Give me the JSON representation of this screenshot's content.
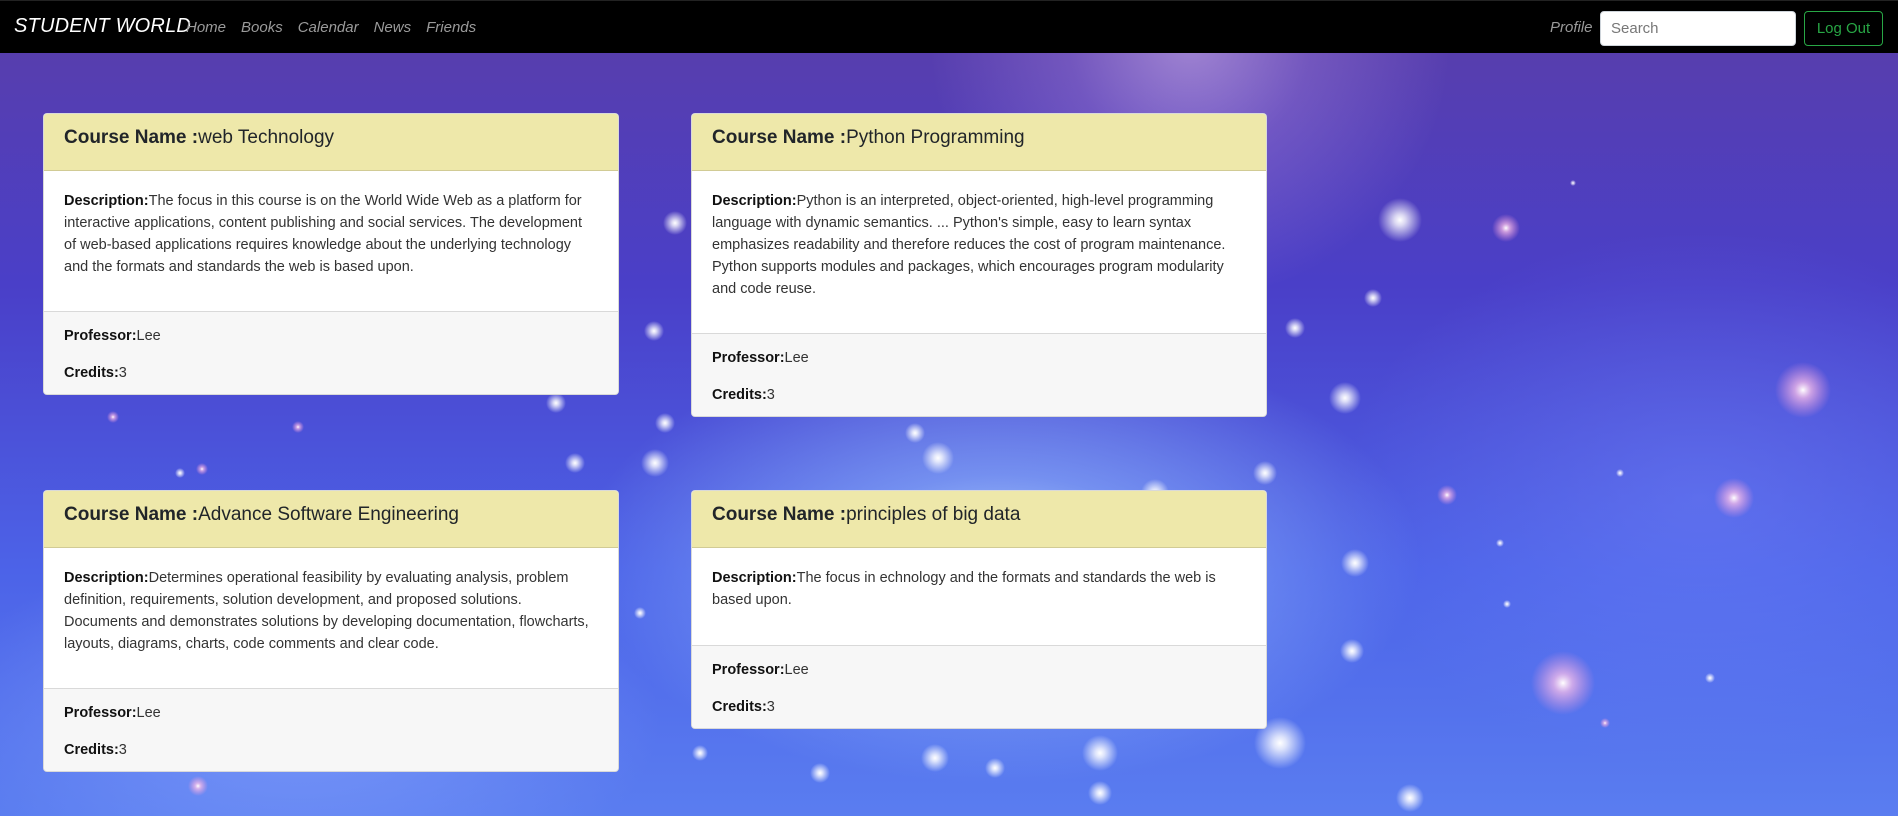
{
  "navbar": {
    "brand": "STUDENT WORLD",
    "links": [
      "Home",
      "Books",
      "Calendar",
      "News",
      "Friends"
    ],
    "profile": "Profile",
    "search_placeholder": "Search",
    "logout_label": "Log Out"
  },
  "labels": {
    "course_name": "Course Name :",
    "description": "Description:",
    "professor": "Professor:",
    "credits": "Credits:"
  },
  "courses": [
    {
      "name": "web Technology",
      "description": "The focus in this course is on the World Wide Web as a platform for interactive applications, content publishing and social services. The development of web-based applications requires knowledge about the underlying technology and the formats and standards the web is based upon.",
      "professor": "Lee",
      "credits": "3"
    },
    {
      "name": "Python Programming",
      "description": "Python is an interpreted, object-oriented, high-level programming language with dynamic semantics. ... Python's simple, easy to learn syntax emphasizes readability and therefore reduces the cost of program maintenance. Python supports modules and packages, which encourages program modularity and code reuse.",
      "professor": "Lee",
      "credits": "3"
    },
    {
      "name": "Advance Software Engineering",
      "description": "Determines operational feasibility by evaluating analysis, problem definition, requirements, solution development, and proposed solutions. Documents and demonstrates solutions by developing documentation, flowcharts, layouts, diagrams, charts, code comments and clear code.",
      "professor": "Lee",
      "credits": "3"
    },
    {
      "name": "principles of big data",
      "description": "The focus in echnology and the formats and standards the web is based upon.",
      "professor": "Lee",
      "credits": "3"
    }
  ],
  "colors": {
    "navbar_bg": "#000000",
    "card_header_bg": "#eee8aa",
    "logout_accent": "#28a745"
  }
}
